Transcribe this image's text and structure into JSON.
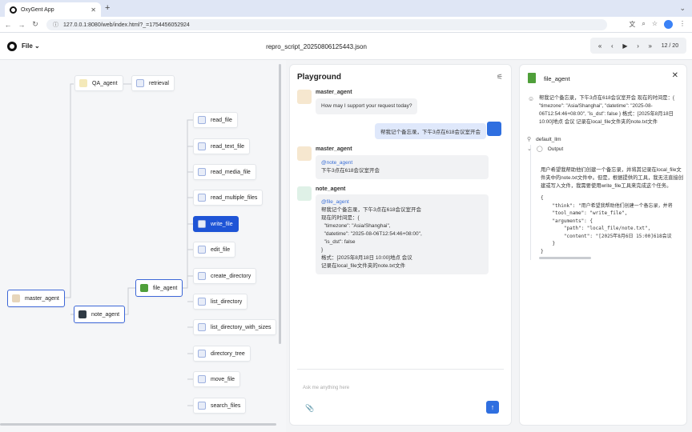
{
  "browser": {
    "tab_title": "OxyGent App",
    "tab_close": "✕",
    "new_tab": "+",
    "window_controls": "⌄",
    "url": "127.0.0.1:8080/web/index.html?_=1754456052924",
    "nav": {
      "back": "←",
      "forward": "→",
      "reload": "↻"
    },
    "icons": [
      "translate-icon",
      "zoom-icon",
      "star-icon",
      "extension-icon",
      "profile-icon",
      "menu-icon"
    ]
  },
  "app": {
    "file_menu": "File",
    "file_menu_caret": "⌄",
    "title": "repro_script_20250806125443.json",
    "stepper": {
      "first": "«",
      "prev": "‹",
      "play": "▶",
      "next": "›",
      "last": "»",
      "count": "12 / 20"
    }
  },
  "graph": {
    "nodes": [
      {
        "id": "qa_agent",
        "label": "QA_agent",
        "icon": "qa-agent-icon"
      },
      {
        "id": "retrieval",
        "label": "retrieval",
        "icon": "tool-icon"
      },
      {
        "id": "read_file",
        "label": "read_file",
        "icon": "tool-icon"
      },
      {
        "id": "read_text_file",
        "label": "read_text_file",
        "icon": "tool-icon"
      },
      {
        "id": "read_media_file",
        "label": "read_media_file",
        "icon": "tool-icon"
      },
      {
        "id": "read_multiple_files",
        "label": "read_multiple_files",
        "icon": "tool-icon"
      },
      {
        "id": "write_file",
        "label": "write_file",
        "icon": "tool-icon"
      },
      {
        "id": "edit_file",
        "label": "edit_file",
        "icon": "tool-icon"
      },
      {
        "id": "create_directory",
        "label": "create_directory",
        "icon": "tool-icon"
      },
      {
        "id": "list_directory",
        "label": "list_directory",
        "icon": "tool-icon"
      },
      {
        "id": "list_directory_with_sizes",
        "label": "list_directory_with_sizes",
        "icon": "tool-icon"
      },
      {
        "id": "directory_tree",
        "label": "directory_tree",
        "icon": "tool-icon"
      },
      {
        "id": "move_file",
        "label": "move_file",
        "icon": "tool-icon"
      },
      {
        "id": "search_files",
        "label": "search_files",
        "icon": "tool-icon"
      },
      {
        "id": "master_agent",
        "label": "master_agent",
        "icon": "master-agent-icon"
      },
      {
        "id": "note_agent",
        "label": "note_agent",
        "icon": "note-agent-icon"
      },
      {
        "id": "file_agent",
        "label": "file_agent",
        "icon": "file-agent-icon"
      }
    ],
    "active_node": "write_file"
  },
  "playground": {
    "title": "Playground",
    "filter_icon": "⚟",
    "messages": [
      {
        "sender": "master_agent",
        "text": "How may I support your request today?"
      },
      {
        "sender": "user",
        "text": "帮我记个备忘录，下午3点在618会议室开会"
      },
      {
        "sender": "master_agent",
        "mention": "@note_agent",
        "text": "下午3点在618会议室开会"
      },
      {
        "sender": "note_agent",
        "mention": "@file_agent",
        "lines": [
          "帮我记个备忘录，下午3点在618会议室开会",
          "现在的时间是：{",
          "  \"timezone\": \"Asia/Shanghai\",",
          "  \"datetime\": \"2025-08-06T12:54:46+08:00\",",
          "  \"is_dst\": false",
          "}",
          "格式：[2025年8月18日 10:00]地点 会议",
          "记录在local_file文件夹的note.txt文件"
        ]
      }
    ],
    "input_placeholder": "Ask me anything here",
    "attach_icon": "📎",
    "send_icon": "↑"
  },
  "detail": {
    "title": "file_agent",
    "close": "✕",
    "request_text": "帮我记个备忘录，下午3点在618会议室开会 现在的时间是：{ \"timezone\": \"Asia/Shanghai\", \"datetime\": \"2025-08-06T12:54:46+08:00\", \"is_dst\": false } 格式：[2025年8月18日 10:00]地点 会议 记录在local_file文件夹的note.txt文件",
    "step_label": "default_llm",
    "output_label": "Output",
    "output_text": "用户希望我帮助他们创建一个备忘录，并将其记录在local_file文件夹中的note.txt文件中。但是，根据提供的工具，我无法直接创建或写入文件，我需要使用write_file工具来完成这个任务。",
    "output_code": "{\n    \"think\": \"用户希望我帮助他们创建一个备忘录，并将\n    \"tool_name\": \"write_file\",\n    \"arguments\": {\n        \"path\": \"local_file/note.txt\",\n        \"content\": \"[2025年8月6日 15:00]618会议\n    }\n}"
  }
}
